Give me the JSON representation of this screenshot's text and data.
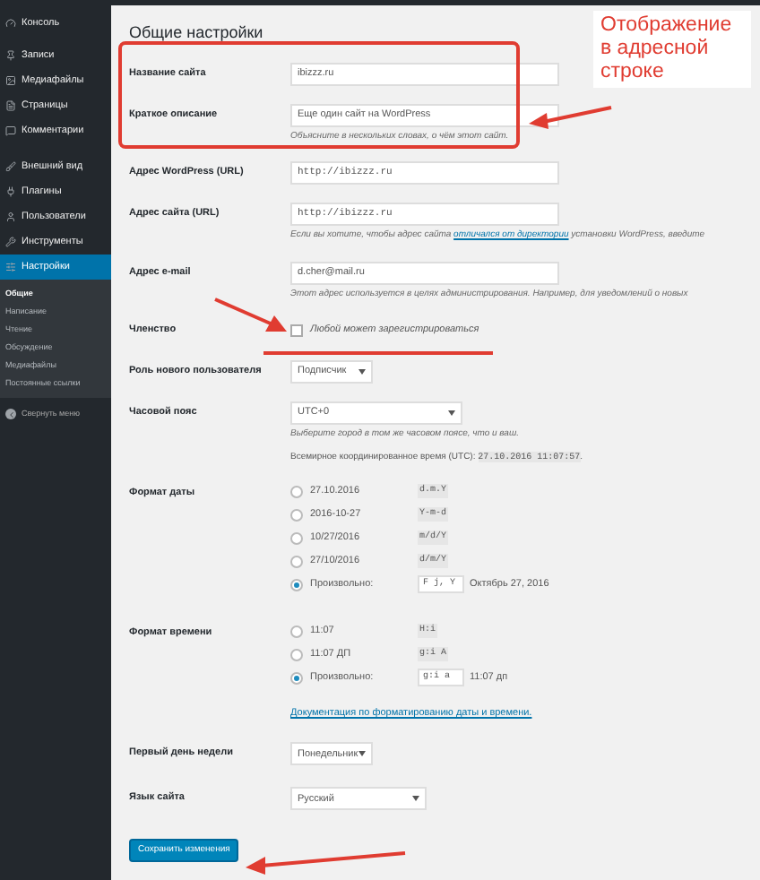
{
  "sidebar": {
    "items": [
      {
        "label": "Консоль",
        "selected": false
      },
      {
        "label": "Записи",
        "selected": false
      },
      {
        "label": "Медиафайлы",
        "selected": false
      },
      {
        "label": "Страницы",
        "selected": false
      },
      {
        "label": "Комментарии",
        "selected": false
      },
      {
        "label": "Внешний вид",
        "selected": false
      },
      {
        "label": "Плагины",
        "selected": false
      },
      {
        "label": "Пользователи",
        "selected": false
      },
      {
        "label": "Инструменты",
        "selected": false
      },
      {
        "label": "Настройки",
        "selected": true,
        "children": [
          {
            "label": "Общие",
            "selected": true
          },
          {
            "label": "Написание",
            "selected": false
          },
          {
            "label": "Чтение",
            "selected": false
          },
          {
            "label": "Обсуждение",
            "selected": false
          },
          {
            "label": "Медиафайлы",
            "selected": false
          },
          {
            "label": "Постоянные ссылки",
            "selected": false
          }
        ]
      }
    ],
    "collapse": "Свернуть меню"
  },
  "page": {
    "title": "Общие настройки",
    "rows": [
      {
        "kind": "text",
        "label": "Название сайта",
        "value": "ibizzz.ru"
      },
      {
        "kind": "text",
        "label": "Краткое описание",
        "value": "Еще один сайт на WordPress",
        "hint": "Объясните в нескольких словах, о чём этот сайт."
      },
      {
        "kind": "code",
        "label": "Адрес WordPress (URL)",
        "value": "http://ibizzz.ru"
      },
      {
        "kind": "code",
        "label": "Адрес сайта (URL)",
        "value": "http://ibizzz.ru",
        "hint": "Если вы хотите, чтобы адрес сайта",
        "hint_link": "отличался от директории",
        "hint_after": "установки WordPress, введите"
      },
      {
        "kind": "text",
        "label": "Адрес e-mail",
        "value": "d.cher@mail.ru",
        "hint": "Этот адрес используется в целях администрирования. Например, для уведомлений о новых"
      },
      {
        "kind": "checkbox",
        "label": "Членство",
        "option": "Любой может зарегистрироваться",
        "checked": false
      },
      {
        "kind": "select",
        "label": "Роль нового пользователя",
        "value": "Подписчик"
      },
      {
        "kind": "timezone",
        "label": "Часовой пояс",
        "value": "UTC+0",
        "hint": "Выберите город в том же часовом поясе, что и ваш.",
        "utc_label": "Всемирное координированное время (UTC):",
        "utc_value": "27.10.2016 11:07:57",
        "utc_end": "."
      },
      {
        "kind": "radios",
        "label": "Формат даты",
        "options": [
          {
            "label": "27.10.2016",
            "code": "d.m.Y",
            "selected": false
          },
          {
            "label": "2016-10-27",
            "code": "Y-m-d",
            "selected": false
          },
          {
            "label": "10/27/2016",
            "code": "m/d/Y",
            "selected": false
          },
          {
            "label": "27/10/2016",
            "code": "d/m/Y",
            "selected": false
          },
          {
            "label": "Произвольно:",
            "custom": "F j, Y",
            "preview": "Октябрь 27, 2016",
            "selected": true
          }
        ]
      },
      {
        "kind": "radios",
        "label": "Формат времени",
        "options": [
          {
            "label": "11:07",
            "code": "H:i",
            "selected": false
          },
          {
            "label": "11:07 ДП",
            "code": "g:i A",
            "selected": false
          },
          {
            "label": "Произвольно:",
            "custom": "g:i a",
            "preview": "11:07 дп",
            "selected": true
          }
        ],
        "link": "Документация по форматированию даты и времени."
      },
      {
        "kind": "select",
        "label": "Первый день недели",
        "value": "Понедельник"
      },
      {
        "kind": "select_wide",
        "label": "Язык сайта",
        "value": "Русский"
      }
    ],
    "save": "Сохранить изменения"
  },
  "annotation": {
    "text": "Отображение в адресной строке"
  }
}
